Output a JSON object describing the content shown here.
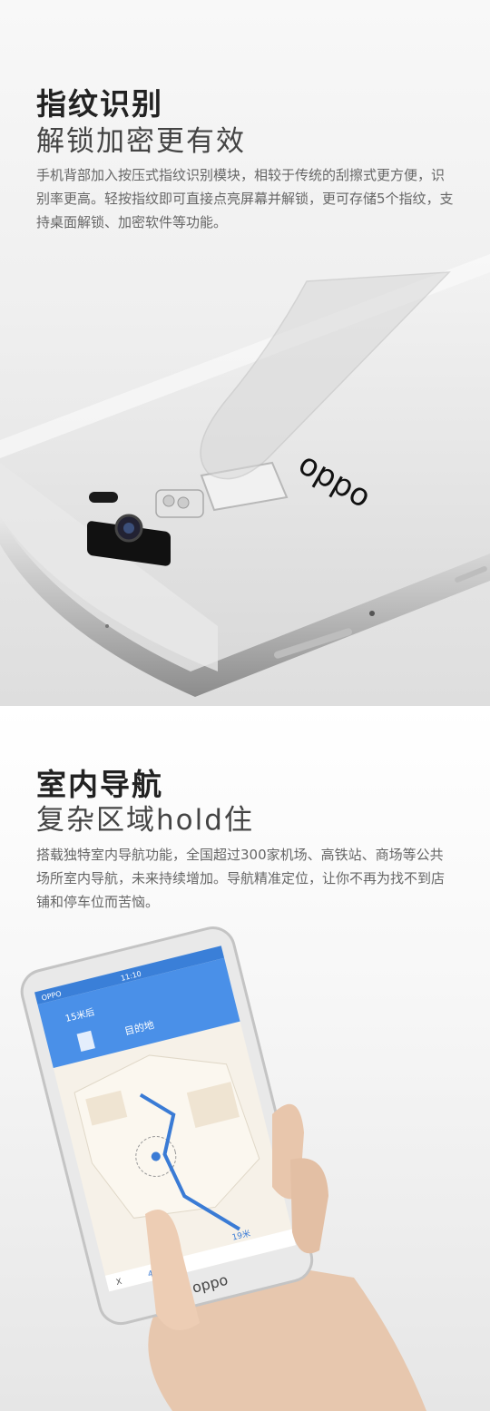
{
  "fingerprint": {
    "title": "指纹识别",
    "subtitle": "解锁加密更有效",
    "description": "手机背部加入按压式指纹识别模块，相较于传统的刮擦式更方便，识别率更高。轻按指纹即可直接点亮屏幕并解锁，更可存储5个指纹，支持桌面解锁、加密软件等功能。",
    "brand_text": "oppo"
  },
  "navigation": {
    "title": "室内导航",
    "subtitle": "复杂区域hold住",
    "description": "搭载独特室内导航功能，全国超过300家机场、高铁站、商场等公共场所室内导航，未来持续增加。导航精准定位，让你不再为找不到店铺和停车位而苦恼。",
    "phone_brand": "oppo",
    "status_carrier": "OPPO",
    "status_time": "11:10",
    "map_start": "15米后",
    "map_dest": "目的地",
    "map_distance": "19米",
    "map_bottom_left": "4分钟",
    "map_close": "X"
  },
  "colors": {
    "map_header": "#4a90e8",
    "route": "#3a7bd5",
    "dark_text": "#222222"
  }
}
